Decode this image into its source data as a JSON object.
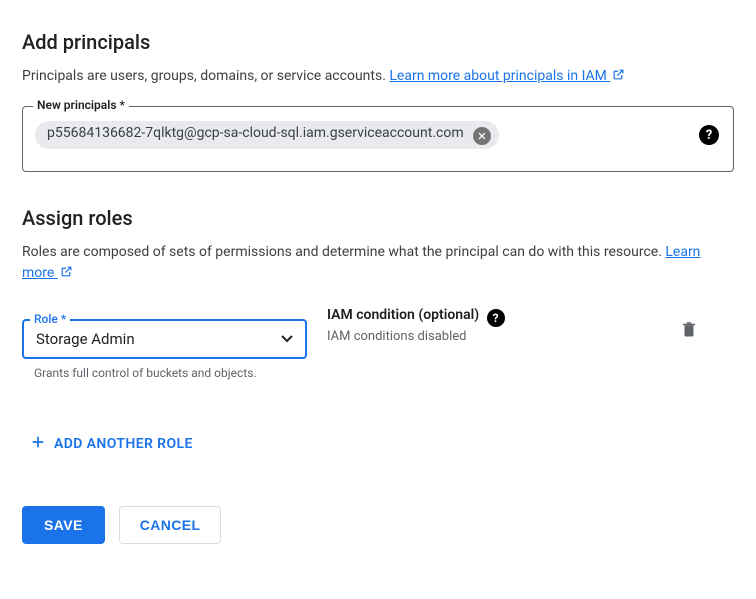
{
  "sections": {
    "addPrincipals": {
      "title": "Add principals",
      "description": "Principals are users, groups, domains, or service accounts. ",
      "learnMore": "Learn more about principals in IAM",
      "fieldLabel": "New principals *",
      "chipValue": "p55684136682-7qlktg@gcp-sa-cloud-sql.iam.gserviceaccount.com"
    },
    "assignRoles": {
      "title": "Assign roles",
      "description": "Roles are composed of sets of permissions and determine what the principal can do with this resource. ",
      "learnMore": "Learn more",
      "role": {
        "label": "Role *",
        "value": "Storage Admin",
        "helper": "Grants full control of buckets and objects."
      },
      "iamCondition": {
        "heading": "IAM condition (optional)",
        "status": "IAM conditions disabled"
      },
      "addAnother": "ADD ANOTHER ROLE"
    }
  },
  "actions": {
    "save": "SAVE",
    "cancel": "CANCEL"
  }
}
